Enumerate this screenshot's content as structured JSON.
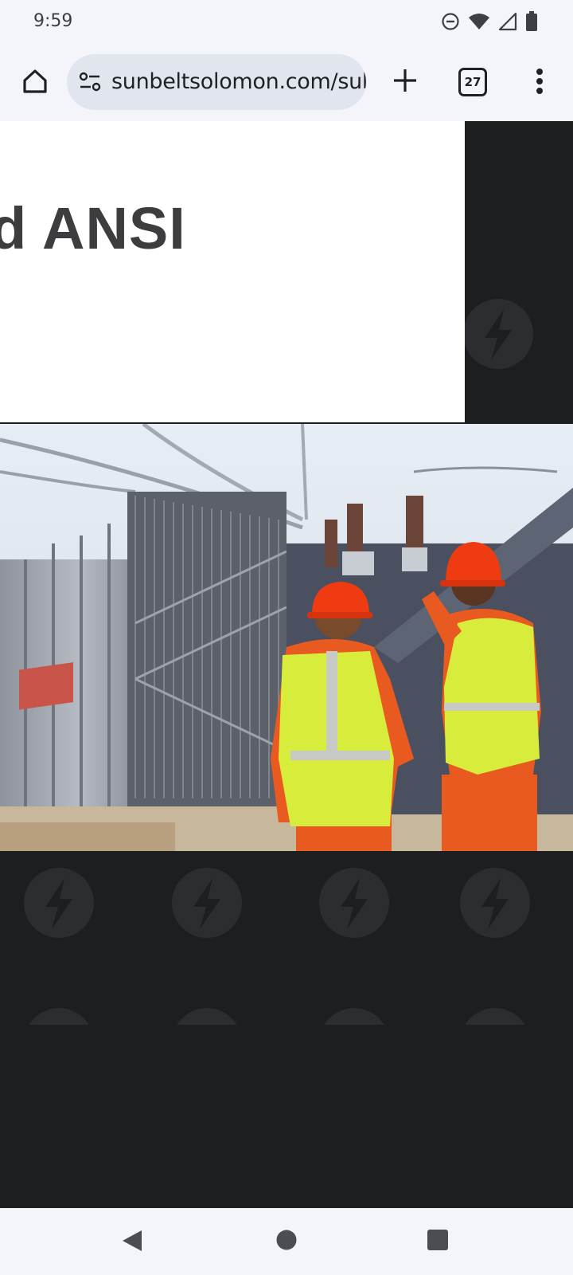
{
  "status_bar": {
    "time": "9:59",
    "icons": [
      "do-not-disturb-icon",
      "wifi-icon",
      "signal-icon",
      "battery-icon"
    ]
  },
  "browser": {
    "url": "sunbeltsolomon.com/sul",
    "tab_count": "27",
    "icons": [
      "home-icon",
      "site-settings-icon",
      "plus-icon",
      "tabs-icon",
      "more-vert-icon"
    ]
  },
  "page": {
    "hero_heading": "d ANSI",
    "photo_description_icon": "image",
    "colors": {
      "dark_background": "#1d1e20",
      "watermark": "#2c2d30",
      "heading": "#3d3d3f"
    }
  },
  "nav_bar": {
    "icons": [
      "back-icon",
      "home-circle-icon",
      "recents-icon"
    ]
  }
}
